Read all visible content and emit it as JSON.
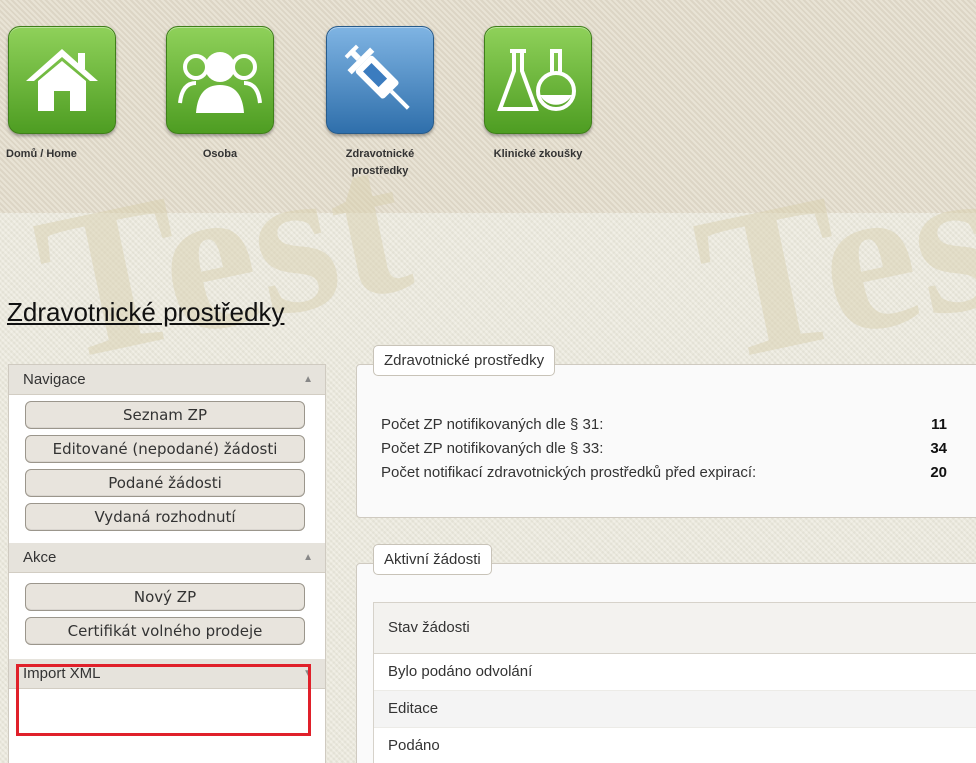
{
  "watermark": "Test",
  "top_nav": [
    {
      "label": "Domů / Home",
      "icon": "home-icon"
    },
    {
      "label": "Osoba",
      "icon": "people-icon"
    },
    {
      "label": "Zdravotnické prostředky",
      "icon": "syringe-icon"
    },
    {
      "label": "Klinické zkoušky",
      "icon": "flask-icon"
    }
  ],
  "page_title": "Zdravotnické prostředky",
  "sidebar": {
    "navigace": {
      "title": "Navigace",
      "items": [
        "Seznam ZP",
        "Editované (nepodané) žádosti",
        "Podané žádosti",
        "Vydaná rozhodnutí"
      ]
    },
    "akce": {
      "title": "Akce",
      "items": [
        "Nový ZP",
        "Certifikát volného prodeje"
      ]
    },
    "import": {
      "title": "Import XML"
    }
  },
  "stats_box": {
    "title": "Zdravotnické prostředky",
    "rows": [
      {
        "label": "Počet ZP notifikovaných dle § 31:",
        "value": "11"
      },
      {
        "label": "Počet ZP notifikovaných dle § 33:",
        "value": "34"
      },
      {
        "label": "Počet notifikací zdravotnických prostředků před expirací:",
        "value": "20"
      }
    ]
  },
  "requests_box": {
    "title": "Aktivní žádosti",
    "column": "Stav žádosti",
    "rows": [
      "Bylo podáno odvolání",
      "Editace",
      "Podáno"
    ]
  },
  "colors": {
    "highlight": "#e0202a",
    "tile_green": "#5aa92c",
    "tile_blue": "#3b7cbf"
  }
}
